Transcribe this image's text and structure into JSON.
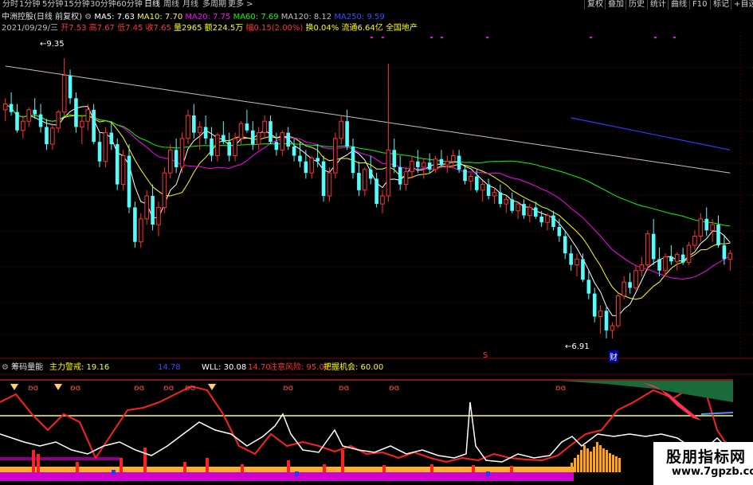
{
  "toolbar": {
    "timeframes": [
      "分时",
      "1分钟",
      "5分钟",
      "15分钟",
      "30分钟",
      "60分钟",
      "日线",
      "周线",
      "月线",
      "多周期",
      "更多 >"
    ],
    "active": "日线",
    "right_buttons": [
      "复权",
      "叠加",
      "历史",
      "统计",
      "曲线",
      "F10",
      "标记",
      "+自选"
    ]
  },
  "stock": {
    "name": "中洲控股(日线 前复权)",
    "ma_labels": [
      "MA5: 7.63",
      "MA10: 7.70",
      "MA20: 7.75",
      "MA60: 7.69",
      "MA120: 8.12",
      "MA250: 9.59"
    ],
    "ma_colors": [
      "#ffffff",
      "#ffff00",
      "#ff00ff",
      "#00ff00",
      "#c0c0c0",
      "#0000ff"
    ],
    "date": "2021/09/29/三",
    "open": "开7.53",
    "high": "高7.67",
    "low": "低7.45",
    "close": "收7.65",
    "volume": "量2965",
    "amount": "额224.5万",
    "change": "幅0.15(2.00%)",
    "turnover": "换0.04%",
    "float": "流通6.64亿",
    "sector": "全国地产"
  },
  "colors": {
    "up": "#ff3232",
    "down": "#54fcfc",
    "ma5": "#ffffff",
    "ma10": "#ffff00",
    "ma20": "#ff00ff",
    "ma60": "#00ff00",
    "ma120": "#c0c0c0",
    "ma250": "#0000ff"
  },
  "annotations": {
    "high_price": "9.35",
    "low_price": "6.91",
    "s_marker": "S",
    "cai_marker": "财"
  },
  "indicator": {
    "name": "筹码量能",
    "zhuli": "主力警戒: 19.16",
    "v1": "14.78",
    "wll": "WLL: 30.08",
    "v2": "14.70",
    "risk": "注意风险: 95.00",
    "opportunity": "把握机会: 60.00"
  },
  "watermark": {
    "line1": "股朋指标网",
    "line2": "www.7gpzb.com"
  },
  "chart_data": {
    "type": "candlestick",
    "high": 9.35,
    "low": 6.91,
    "ylim": [
      6.75,
      9.55
    ],
    "candles": [
      [
        8.9,
        9.0,
        8.8,
        8.95
      ],
      [
        8.95,
        9.05,
        8.85,
        8.88
      ],
      [
        8.88,
        8.95,
        8.7,
        8.72
      ],
      [
        8.72,
        8.85,
        8.65,
        8.8
      ],
      [
        8.8,
        8.92,
        8.75,
        8.9
      ],
      [
        8.9,
        9.0,
        8.82,
        8.86
      ],
      [
        8.86,
        8.95,
        8.7,
        8.75
      ],
      [
        8.75,
        8.82,
        8.55,
        8.6
      ],
      [
        8.6,
        8.78,
        8.55,
        8.74
      ],
      [
        8.74,
        8.9,
        8.7,
        8.88
      ],
      [
        8.88,
        9.35,
        8.85,
        9.2
      ],
      [
        9.2,
        9.25,
        8.95,
        9.0
      ],
      [
        9.0,
        9.05,
        8.7,
        8.75
      ],
      [
        8.75,
        8.85,
        8.6,
        8.8
      ],
      [
        8.8,
        8.95,
        8.72,
        8.9
      ],
      [
        8.9,
        8.95,
        8.6,
        8.62
      ],
      [
        8.62,
        8.7,
        8.4,
        8.45
      ],
      [
        8.45,
        8.75,
        8.4,
        8.7
      ],
      [
        8.7,
        8.8,
        8.55,
        8.6
      ],
      [
        8.6,
        8.65,
        8.2,
        8.25
      ],
      [
        8.25,
        8.55,
        8.2,
        8.5
      ],
      [
        8.5,
        8.6,
        8.0,
        8.05
      ],
      [
        8.05,
        8.1,
        7.7,
        7.75
      ],
      [
        7.75,
        8.0,
        7.7,
        7.95
      ],
      [
        7.95,
        8.2,
        7.9,
        8.15
      ],
      [
        8.15,
        8.25,
        7.85,
        7.9
      ],
      [
        7.9,
        8.1,
        7.8,
        8.05
      ],
      [
        8.05,
        8.4,
        8.0,
        8.35
      ],
      [
        8.35,
        8.6,
        8.3,
        8.55
      ],
      [
        8.55,
        8.65,
        8.35,
        8.4
      ],
      [
        8.4,
        8.7,
        8.35,
        8.65
      ],
      [
        8.65,
        8.9,
        8.6,
        8.85
      ],
      [
        8.85,
        8.95,
        8.65,
        8.7
      ],
      [
        8.7,
        8.8,
        8.55,
        8.75
      ],
      [
        8.75,
        8.85,
        8.6,
        8.65
      ],
      [
        8.65,
        8.75,
        8.45,
        8.5
      ],
      [
        8.5,
        8.7,
        8.45,
        8.68
      ],
      [
        8.68,
        8.8,
        8.6,
        8.62
      ],
      [
        8.62,
        8.7,
        8.45,
        8.5
      ],
      [
        8.5,
        8.7,
        8.45,
        8.65
      ],
      [
        8.65,
        8.8,
        8.6,
        8.78
      ],
      [
        8.78,
        8.9,
        8.7,
        8.72
      ],
      [
        8.72,
        8.8,
        8.55,
        8.6
      ],
      [
        8.6,
        8.75,
        8.55,
        8.7
      ],
      [
        8.7,
        8.85,
        8.65,
        8.8
      ],
      [
        8.8,
        8.85,
        8.6,
        8.62
      ],
      [
        8.62,
        8.7,
        8.5,
        8.55
      ],
      [
        8.55,
        8.72,
        8.5,
        8.7
      ],
      [
        8.7,
        8.75,
        8.55,
        8.58
      ],
      [
        8.58,
        8.65,
        8.45,
        8.5
      ],
      [
        8.5,
        8.62,
        8.4,
        8.45
      ],
      [
        8.45,
        8.55,
        8.3,
        8.35
      ],
      [
        8.35,
        8.5,
        8.3,
        8.48
      ],
      [
        8.48,
        8.6,
        8.4,
        8.45
      ],
      [
        8.45,
        8.5,
        8.1,
        8.15
      ],
      [
        8.15,
        8.4,
        8.1,
        8.35
      ],
      [
        8.35,
        8.7,
        8.3,
        8.65
      ],
      [
        8.65,
        8.85,
        8.6,
        8.8
      ],
      [
        8.8,
        8.9,
        8.55,
        8.58
      ],
      [
        8.58,
        8.65,
        8.3,
        8.35
      ],
      [
        8.35,
        8.45,
        8.15,
        8.2
      ],
      [
        8.2,
        8.4,
        8.15,
        8.38
      ],
      [
        8.38,
        8.5,
        8.25,
        8.3
      ],
      [
        8.3,
        8.35,
        8.05,
        8.08
      ],
      [
        8.08,
        8.2,
        8.0,
        8.15
      ],
      [
        8.15,
        9.3,
        8.1,
        8.55
      ],
      [
        8.55,
        8.65,
        8.35,
        8.4
      ],
      [
        8.4,
        8.5,
        8.2,
        8.25
      ],
      [
        8.25,
        8.4,
        8.2,
        8.36
      ],
      [
        8.36,
        8.5,
        8.3,
        8.45
      ],
      [
        8.45,
        8.55,
        8.35,
        8.4
      ],
      [
        8.4,
        8.48,
        8.3,
        8.44
      ],
      [
        8.44,
        8.52,
        8.35,
        8.38
      ],
      [
        8.38,
        8.5,
        8.35,
        8.47
      ],
      [
        8.47,
        8.55,
        8.4,
        8.42
      ],
      [
        8.42,
        8.5,
        8.35,
        8.45
      ],
      [
        8.45,
        8.55,
        8.4,
        8.5
      ],
      [
        8.5,
        8.55,
        8.35,
        8.38
      ],
      [
        8.38,
        8.42,
        8.25,
        8.28
      ],
      [
        8.28,
        8.35,
        8.2,
        8.32
      ],
      [
        8.32,
        8.38,
        8.18,
        8.2
      ],
      [
        8.2,
        8.28,
        8.1,
        8.25
      ],
      [
        8.25,
        8.3,
        8.12,
        8.15
      ],
      [
        8.15,
        8.22,
        8.08,
        8.18
      ],
      [
        8.18,
        8.25,
        8.05,
        8.08
      ],
      [
        8.08,
        8.15,
        8.0,
        8.12
      ],
      [
        8.12,
        8.18,
        8.0,
        8.02
      ],
      [
        8.02,
        8.1,
        7.95,
        8.08
      ],
      [
        8.08,
        8.12,
        7.95,
        7.98
      ],
      [
        7.98,
        8.08,
        7.92,
        8.05
      ],
      [
        8.05,
        8.1,
        7.95,
        7.97
      ],
      [
        7.97,
        8.02,
        7.88,
        7.92
      ],
      [
        7.92,
        8.0,
        7.85,
        7.98
      ],
      [
        7.98,
        8.02,
        7.85,
        7.88
      ],
      [
        7.88,
        7.95,
        7.75,
        7.8
      ],
      [
        7.8,
        7.85,
        7.6,
        7.65
      ],
      [
        7.65,
        7.72,
        7.5,
        7.55
      ],
      [
        7.55,
        7.65,
        7.45,
        7.6
      ],
      [
        7.6,
        7.65,
        7.4,
        7.42
      ],
      [
        7.42,
        7.5,
        7.25,
        7.3
      ],
      [
        7.3,
        7.35,
        7.05,
        7.1
      ],
      [
        7.1,
        7.2,
        6.95,
        7.15
      ],
      [
        7.15,
        7.18,
        6.91,
        6.98
      ],
      [
        6.98,
        7.05,
        6.91,
        7.02
      ],
      [
        7.02,
        7.3,
        7.0,
        7.28
      ],
      [
        7.28,
        7.45,
        7.25,
        7.4
      ],
      [
        7.4,
        7.48,
        7.3,
        7.35
      ],
      [
        7.35,
        7.55,
        7.33,
        7.5
      ],
      [
        7.5,
        7.62,
        7.45,
        7.55
      ],
      [
        7.55,
        7.85,
        7.5,
        7.82
      ],
      [
        7.82,
        7.95,
        7.55,
        7.6
      ],
      [
        7.6,
        7.7,
        7.45,
        7.5
      ],
      [
        7.5,
        7.65,
        7.45,
        7.62
      ],
      [
        7.62,
        7.72,
        7.55,
        7.58
      ],
      [
        7.58,
        7.66,
        7.5,
        7.64
      ],
      [
        7.64,
        7.7,
        7.55,
        7.57
      ],
      [
        7.57,
        7.75,
        7.55,
        7.72
      ],
      [
        7.72,
        7.85,
        7.68,
        7.8
      ],
      [
        7.8,
        8.0,
        7.75,
        7.95
      ],
      [
        7.95,
        8.05,
        7.8,
        7.85
      ],
      [
        7.85,
        7.95,
        7.75,
        7.9
      ],
      [
        7.9,
        7.98,
        7.7,
        7.72
      ],
      [
        7.72,
        7.8,
        7.55,
        7.6
      ],
      [
        7.6,
        7.68,
        7.5,
        7.65
      ]
    ],
    "overlay_lines": [
      {
        "name": "MA5",
        "color": "#ffffff"
      },
      {
        "name": "MA10",
        "color": "#ffff00"
      },
      {
        "name": "MA20",
        "color": "#ff00ff"
      },
      {
        "name": "MA60",
        "color": "#00ff00"
      },
      {
        "name": "MA120",
        "color": "#c0c0c0"
      },
      {
        "name": "MA250",
        "color": "#0000ff"
      }
    ]
  }
}
